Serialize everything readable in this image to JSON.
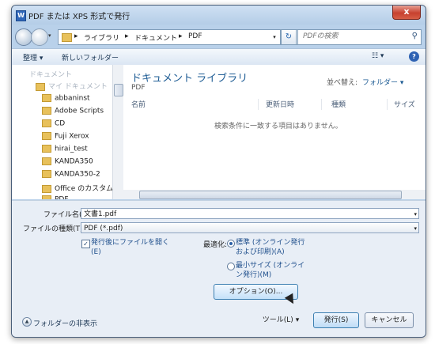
{
  "window": {
    "title": "PDF または XPS 形式で発行",
    "app_icon": "W",
    "close_label": "x"
  },
  "address": {
    "crumbs": [
      "ライブラリ",
      "ドキュメント",
      "PDF"
    ],
    "separator": "▸",
    "refresh_glyph": "↻",
    "search_placeholder": "PDFの検索"
  },
  "toolbar": {
    "organize": "整理 ▾",
    "new_folder": "新しいフォルダー",
    "view_glyph": "☷ ▾",
    "help": "?"
  },
  "sidebar": {
    "items": [
      {
        "label": "ドキュメント",
        "folder": false,
        "faded": true
      },
      {
        "label": "マイ ドキュメント",
        "folder": true,
        "faded": true
      },
      {
        "label": "abbaninst",
        "folder": true,
        "faded": false
      },
      {
        "label": "Adobe Scripts",
        "folder": true,
        "faded": false
      },
      {
        "label": "CD",
        "folder": true,
        "faded": false
      },
      {
        "label": "Fuji Xerox",
        "folder": true,
        "faded": false
      },
      {
        "label": "hirai_test",
        "folder": true,
        "faded": false
      },
      {
        "label": "KANDA350",
        "folder": true,
        "faded": false
      },
      {
        "label": "KANDA350-2",
        "folder": true,
        "faded": false
      },
      {
        "label": "Office のカスタム テ",
        "folder": true,
        "faded": false
      },
      {
        "label": "PDF",
        "folder": true,
        "faded": false
      }
    ]
  },
  "content": {
    "title": "ドキュメント ライブラリ",
    "subtitle": "PDF",
    "sort_label": "並べ替え:",
    "sort_value": "フォルダー ▾",
    "columns": [
      "名前",
      "更新日時",
      "種類",
      "サイズ"
    ],
    "empty_message": "検索条件に一致する項目はありません。"
  },
  "form": {
    "filename_label": "ファイル名(N):",
    "filename_value": "文書1.pdf",
    "filetype_label": "ファイルの種類(T):",
    "filetype_value": "PDF (*.pdf)",
    "open_after_line1": "発行後にファイルを開く",
    "open_after_line2": "(E)",
    "open_after_checked": true,
    "optimize_label": "最適化:",
    "opt_standard_line1": "標準 (オンライン発行",
    "opt_standard_line2": "および印刷)(A)",
    "opt_min_line1": "最小サイズ (オンライ",
    "opt_min_line2": "ン発行)(M)",
    "selected_option": "standard",
    "options_button": "オプション(O)...",
    "hide_folders": "フォルダーの非表示",
    "tools_button": "ツール(L)",
    "publish_button": "発行(S)",
    "cancel_button": "キャンセル",
    "dropdown_glyph": "▾",
    "checkmark_glyph": "✓"
  }
}
